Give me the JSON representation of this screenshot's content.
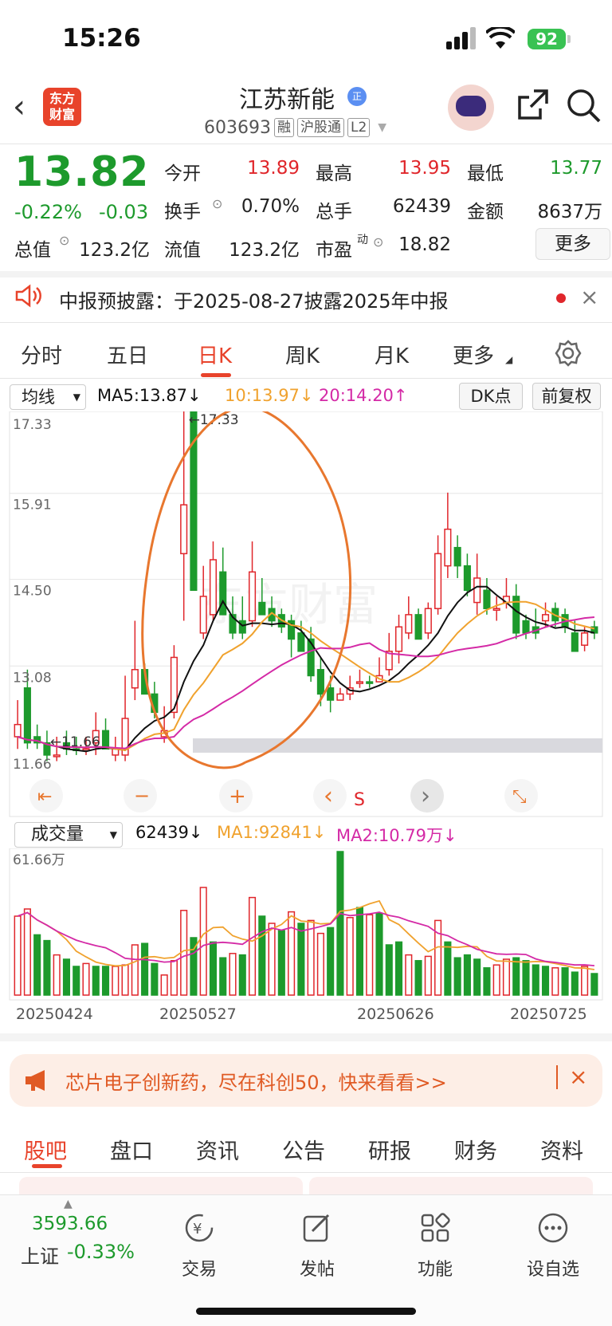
{
  "status": {
    "time": "15:26",
    "battery": "92"
  },
  "header": {
    "logo_line1": "东方",
    "logo_line2": "财富",
    "stock_name": "江苏新能",
    "stock_code": "603693",
    "tags": [
      "融",
      "沪股通",
      "L2"
    ]
  },
  "quote": {
    "price": "13.82",
    "change_pct": "-0.22%",
    "change": "-0.03",
    "rows": [
      [
        {
          "label": "今开",
          "value": "13.89",
          "color": "red"
        },
        {
          "label": "最高",
          "value": "13.95",
          "color": "red"
        },
        {
          "label": "最低",
          "value": "13.77",
          "color": "green"
        }
      ],
      [
        {
          "label": "换手",
          "value": "0.70%",
          "color": "normal"
        },
        {
          "label": "总手",
          "value": "62439",
          "color": "normal"
        },
        {
          "label": "金额",
          "value": "8637万",
          "color": "normal"
        }
      ],
      [
        {
          "label": "总值",
          "value": "123.2亿",
          "color": "normal"
        },
        {
          "label": "流值",
          "value": "123.2亿",
          "color": "normal"
        },
        {
          "label": "市盈",
          "sup": "动",
          "value": "18.82",
          "color": "normal"
        }
      ]
    ],
    "more_label": "更多"
  },
  "notice": {
    "text": "中报预披露：于2025-08-27披露2025年中报"
  },
  "chart_tabs": [
    "分时",
    "五日",
    "日K",
    "周K",
    "月K",
    "更多"
  ],
  "active_chart_tab": "日K",
  "ma_bar": {
    "selector": "均线",
    "ma5": "MA5:13.87↓",
    "ma10": "10:13.97↓",
    "ma20": "20:14.20↑",
    "dk": "DK点",
    "fq": "前复权"
  },
  "volume_bar": {
    "selector": "成交量",
    "vol": "62439↓",
    "ma1": "MA1:92841↓",
    "ma2": "MA2:10.79万↓"
  },
  "chart_data": {
    "type": "candlestick",
    "price_axis": {
      "labels": [
        "17.33",
        "15.91",
        "14.50",
        "13.08",
        "11.66"
      ],
      "range": [
        11.66,
        17.33
      ]
    },
    "max_marker": "←17.33",
    "min_marker": "←11.66",
    "volume_axis_label": "61.66万",
    "date_labels": [
      "20250424",
      "20250527",
      "20250626",
      "20250725"
    ],
    "watermark": "东方财富",
    "handwritten_s": "S",
    "candles": [
      [
        12.2,
        12.6,
        12.0,
        11.8,
        "u"
      ],
      [
        12.8,
        13.1,
        11.9,
        11.8,
        "d"
      ],
      [
        12.0,
        12.2,
        11.9,
        11.8,
        "d"
      ],
      [
        11.9,
        12.1,
        11.7,
        11.6,
        "d"
      ],
      [
        11.7,
        12.0,
        11.7,
        11.6,
        "u"
      ],
      [
        11.9,
        12.1,
        11.8,
        11.7,
        "d"
      ],
      [
        11.8,
        12.0,
        11.8,
        11.7,
        "d"
      ],
      [
        11.8,
        12.0,
        11.8,
        11.7,
        "u"
      ],
      [
        12.1,
        12.4,
        11.9,
        11.7,
        "u"
      ],
      [
        12.1,
        12.3,
        11.8,
        11.8,
        "d"
      ],
      [
        11.8,
        12.0,
        11.7,
        11.6,
        "u"
      ],
      [
        12.3,
        13.0,
        11.7,
        11.6,
        "u"
      ],
      [
        13.1,
        13.9,
        12.8,
        12.6,
        "u"
      ],
      [
        13.1,
        13.2,
        12.7,
        12.7,
        "d"
      ],
      [
        12.7,
        12.9,
        12.4,
        12.3,
        "d"
      ],
      [
        12.1,
        12.5,
        12.0,
        11.9,
        "u"
      ],
      [
        13.3,
        13.5,
        12.4,
        12.3,
        "u"
      ],
      [
        15.8,
        17.33,
        15.0,
        13.9,
        "u"
      ],
      [
        17.33,
        17.33,
        14.4,
        14.4,
        "d"
      ],
      [
        14.3,
        14.8,
        13.7,
        13.6,
        "u"
      ],
      [
        14.9,
        15.2,
        14.0,
        13.9,
        "u"
      ],
      [
        14.7,
        15.1,
        14.0,
        14.0,
        "d"
      ],
      [
        14.0,
        14.3,
        13.7,
        13.6,
        "d"
      ],
      [
        13.9,
        14.3,
        13.7,
        13.6,
        "d"
      ],
      [
        14.7,
        15.2,
        13.9,
        13.8,
        "u"
      ],
      [
        14.2,
        14.6,
        14.0,
        14.0,
        "d"
      ],
      [
        14.1,
        14.3,
        13.9,
        13.8,
        "d"
      ],
      [
        14.0,
        14.1,
        13.8,
        13.7,
        "d"
      ],
      [
        13.9,
        14.0,
        13.6,
        13.3,
        "d"
      ],
      [
        13.7,
        13.9,
        13.4,
        13.4,
        "d"
      ],
      [
        13.6,
        13.8,
        13.0,
        12.9,
        "d"
      ],
      [
        13.1,
        13.3,
        12.7,
        12.5,
        "d"
      ],
      [
        12.8,
        13.0,
        12.6,
        12.4,
        "d"
      ],
      [
        12.6,
        12.8,
        12.7,
        12.6,
        "u"
      ],
      [
        12.7,
        13.0,
        12.8,
        12.6,
        "u"
      ],
      [
        12.9,
        13.1,
        12.9,
        12.8,
        "u"
      ],
      [
        12.9,
        13.0,
        12.9,
        12.8,
        "d"
      ],
      [
        13.0,
        13.3,
        12.9,
        12.9,
        "u"
      ],
      [
        13.4,
        13.7,
        13.1,
        13.0,
        "u"
      ],
      [
        13.8,
        14.0,
        13.4,
        13.2,
        "u"
      ],
      [
        14.0,
        14.3,
        13.7,
        13.6,
        "u"
      ],
      [
        14.0,
        14.1,
        13.6,
        13.6,
        "d"
      ],
      [
        14.1,
        14.2,
        13.7,
        13.6,
        "u"
      ],
      [
        15.0,
        15.3,
        14.1,
        14.0,
        "u"
      ],
      [
        15.4,
        16.0,
        14.8,
        14.6,
        "u"
      ],
      [
        15.1,
        15.3,
        14.8,
        14.6,
        "d"
      ],
      [
        14.8,
        15.0,
        14.4,
        14.3,
        "d"
      ],
      [
        14.6,
        15.0,
        14.2,
        14.0,
        "u"
      ],
      [
        14.4,
        14.6,
        14.1,
        14.0,
        "d"
      ],
      [
        14.1,
        14.3,
        14.1,
        13.9,
        "u"
      ],
      [
        14.3,
        14.6,
        14.2,
        14.1,
        "u"
      ],
      [
        14.3,
        14.5,
        13.7,
        13.6,
        "d"
      ],
      [
        13.9,
        14.0,
        13.7,
        13.6,
        "d"
      ],
      [
        13.8,
        14.1,
        13.7,
        13.6,
        "d"
      ],
      [
        14.0,
        14.2,
        13.9,
        13.8,
        "u"
      ],
      [
        14.1,
        14.2,
        13.9,
        13.8,
        "d"
      ],
      [
        14.0,
        14.1,
        13.8,
        13.7,
        "d"
      ],
      [
        13.7,
        13.9,
        13.4,
        13.4,
        "d"
      ],
      [
        13.5,
        13.8,
        13.7,
        13.4,
        "u"
      ],
      [
        13.8,
        13.9,
        13.7,
        13.6,
        "d"
      ]
    ],
    "volumes": [
      [
        0.55,
        "u"
      ],
      [
        0.6,
        "u"
      ],
      [
        0.42,
        "d"
      ],
      [
        0.38,
        "d"
      ],
      [
        0.28,
        "u"
      ],
      [
        0.25,
        "d"
      ],
      [
        0.2,
        "d"
      ],
      [
        0.22,
        "u"
      ],
      [
        0.2,
        "d"
      ],
      [
        0.2,
        "d"
      ],
      [
        0.2,
        "u"
      ],
      [
        0.21,
        "u"
      ],
      [
        0.35,
        "u"
      ],
      [
        0.36,
        "d"
      ],
      [
        0.22,
        "d"
      ],
      [
        0.14,
        "u"
      ],
      [
        0.24,
        "u"
      ],
      [
        0.59,
        "u"
      ],
      [
        0.4,
        "d"
      ],
      [
        0.75,
        "u"
      ],
      [
        0.37,
        "d"
      ],
      [
        0.26,
        "d"
      ],
      [
        0.29,
        "u"
      ],
      [
        0.28,
        "d"
      ],
      [
        0.68,
        "u"
      ],
      [
        0.55,
        "d"
      ],
      [
        0.5,
        "u"
      ],
      [
        0.45,
        "d"
      ],
      [
        0.58,
        "u"
      ],
      [
        0.5,
        "d"
      ],
      [
        0.52,
        "u"
      ],
      [
        0.43,
        "u"
      ],
      [
        0.47,
        "d"
      ],
      [
        1.0,
        "d"
      ],
      [
        0.54,
        "u"
      ],
      [
        0.61,
        "d"
      ],
      [
        0.56,
        "u"
      ],
      [
        0.57,
        "d"
      ],
      [
        0.35,
        "d"
      ],
      [
        0.37,
        "d"
      ],
      [
        0.28,
        "u"
      ],
      [
        0.24,
        "d"
      ],
      [
        0.27,
        "u"
      ],
      [
        0.52,
        "u"
      ],
      [
        0.37,
        "d"
      ],
      [
        0.26,
        "d"
      ],
      [
        0.28,
        "d"
      ],
      [
        0.25,
        "d"
      ],
      [
        0.19,
        "d"
      ],
      [
        0.21,
        "u"
      ],
      [
        0.25,
        "u"
      ],
      [
        0.26,
        "d"
      ],
      [
        0.24,
        "d"
      ],
      [
        0.21,
        "d"
      ],
      [
        0.2,
        "d"
      ],
      [
        0.19,
        "u"
      ],
      [
        0.19,
        "d"
      ],
      [
        0.16,
        "d"
      ],
      [
        0.2,
        "u"
      ],
      [
        0.15,
        "d"
      ]
    ]
  },
  "chart_controls": [
    "⇤",
    "−",
    "+",
    "‹",
    "›",
    "⤡"
  ],
  "promo": {
    "text": "芯片电子创新药，尽在科创50，快来看看>>"
  },
  "bottom_tabs": [
    "股吧",
    "盘口",
    "资讯",
    "公告",
    "研报",
    "财务",
    "资料"
  ],
  "index": {
    "value": "3593.66",
    "label": "上证",
    "change": "-0.33%"
  },
  "nav": [
    {
      "label": "交易",
      "icon": "trade-icon"
    },
    {
      "label": "发帖",
      "icon": "post-icon"
    },
    {
      "label": "功能",
      "icon": "grid-icon"
    },
    {
      "label": "设自选",
      "icon": "more-icon"
    }
  ],
  "colors": {
    "up": "#e0262b",
    "down": "#1d9a2c",
    "ma5": "#111111",
    "ma10": "#f0a22e",
    "ma20": "#d42aa6",
    "accent": "#e8432b",
    "annotation": "#e8772e"
  }
}
